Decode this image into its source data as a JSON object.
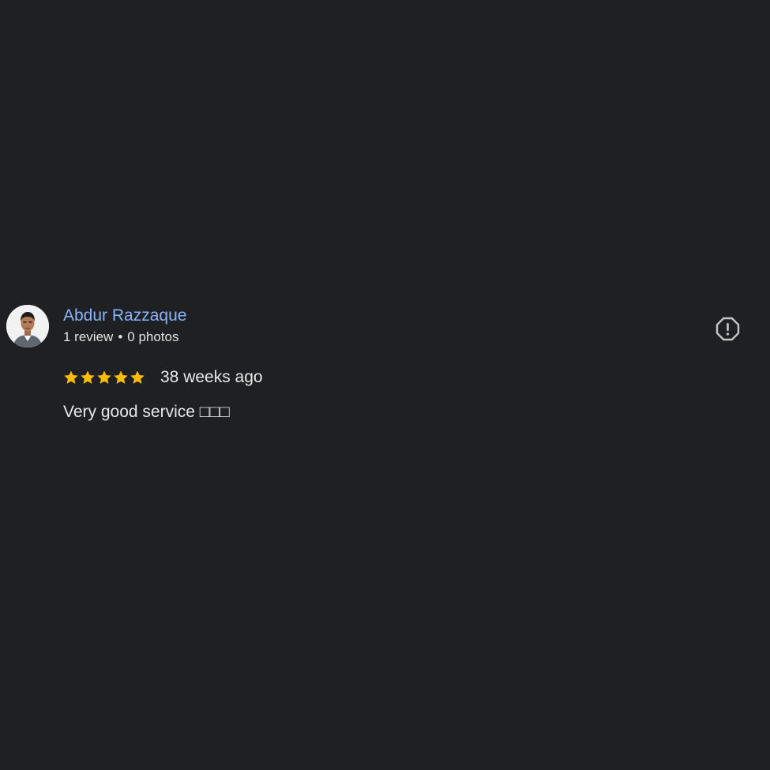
{
  "review": {
    "author": {
      "name": "Abdur Razzaque",
      "reviews": "1 review",
      "separator": "•",
      "photos": "0 photos",
      "avatar_icon": "profile-photo"
    },
    "rating": {
      "stars": 5,
      "max": 5,
      "color": "#fbbc04"
    },
    "time_ago": "38 weeks ago",
    "text": "Very good service □□□",
    "report_icon": "report-icon"
  },
  "colors": {
    "background": "#1f2024",
    "author_link": "#8ab4f8",
    "text": "#e8e8e8"
  }
}
